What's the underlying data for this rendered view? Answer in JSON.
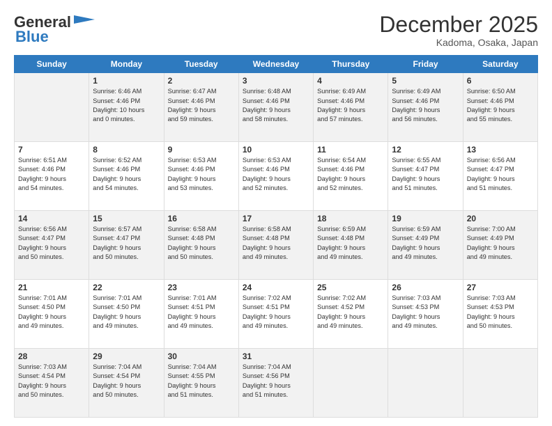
{
  "header": {
    "logo_line1": "General",
    "logo_line2": "Blue",
    "month": "December 2025",
    "location": "Kadoma, Osaka, Japan"
  },
  "weekdays": [
    "Sunday",
    "Monday",
    "Tuesday",
    "Wednesday",
    "Thursday",
    "Friday",
    "Saturday"
  ],
  "rows": [
    [
      {
        "num": "",
        "info": ""
      },
      {
        "num": "1",
        "info": "Sunrise: 6:46 AM\nSunset: 4:46 PM\nDaylight: 10 hours\nand 0 minutes."
      },
      {
        "num": "2",
        "info": "Sunrise: 6:47 AM\nSunset: 4:46 PM\nDaylight: 9 hours\nand 59 minutes."
      },
      {
        "num": "3",
        "info": "Sunrise: 6:48 AM\nSunset: 4:46 PM\nDaylight: 9 hours\nand 58 minutes."
      },
      {
        "num": "4",
        "info": "Sunrise: 6:49 AM\nSunset: 4:46 PM\nDaylight: 9 hours\nand 57 minutes."
      },
      {
        "num": "5",
        "info": "Sunrise: 6:49 AM\nSunset: 4:46 PM\nDaylight: 9 hours\nand 56 minutes."
      },
      {
        "num": "6",
        "info": "Sunrise: 6:50 AM\nSunset: 4:46 PM\nDaylight: 9 hours\nand 55 minutes."
      }
    ],
    [
      {
        "num": "7",
        "info": "Sunrise: 6:51 AM\nSunset: 4:46 PM\nDaylight: 9 hours\nand 54 minutes."
      },
      {
        "num": "8",
        "info": "Sunrise: 6:52 AM\nSunset: 4:46 PM\nDaylight: 9 hours\nand 54 minutes."
      },
      {
        "num": "9",
        "info": "Sunrise: 6:53 AM\nSunset: 4:46 PM\nDaylight: 9 hours\nand 53 minutes."
      },
      {
        "num": "10",
        "info": "Sunrise: 6:53 AM\nSunset: 4:46 PM\nDaylight: 9 hours\nand 52 minutes."
      },
      {
        "num": "11",
        "info": "Sunrise: 6:54 AM\nSunset: 4:46 PM\nDaylight: 9 hours\nand 52 minutes."
      },
      {
        "num": "12",
        "info": "Sunrise: 6:55 AM\nSunset: 4:47 PM\nDaylight: 9 hours\nand 51 minutes."
      },
      {
        "num": "13",
        "info": "Sunrise: 6:56 AM\nSunset: 4:47 PM\nDaylight: 9 hours\nand 51 minutes."
      }
    ],
    [
      {
        "num": "14",
        "info": "Sunrise: 6:56 AM\nSunset: 4:47 PM\nDaylight: 9 hours\nand 50 minutes."
      },
      {
        "num": "15",
        "info": "Sunrise: 6:57 AM\nSunset: 4:47 PM\nDaylight: 9 hours\nand 50 minutes."
      },
      {
        "num": "16",
        "info": "Sunrise: 6:58 AM\nSunset: 4:48 PM\nDaylight: 9 hours\nand 50 minutes."
      },
      {
        "num": "17",
        "info": "Sunrise: 6:58 AM\nSunset: 4:48 PM\nDaylight: 9 hours\nand 49 minutes."
      },
      {
        "num": "18",
        "info": "Sunrise: 6:59 AM\nSunset: 4:48 PM\nDaylight: 9 hours\nand 49 minutes."
      },
      {
        "num": "19",
        "info": "Sunrise: 6:59 AM\nSunset: 4:49 PM\nDaylight: 9 hours\nand 49 minutes."
      },
      {
        "num": "20",
        "info": "Sunrise: 7:00 AM\nSunset: 4:49 PM\nDaylight: 9 hours\nand 49 minutes."
      }
    ],
    [
      {
        "num": "21",
        "info": "Sunrise: 7:01 AM\nSunset: 4:50 PM\nDaylight: 9 hours\nand 49 minutes."
      },
      {
        "num": "22",
        "info": "Sunrise: 7:01 AM\nSunset: 4:50 PM\nDaylight: 9 hours\nand 49 minutes."
      },
      {
        "num": "23",
        "info": "Sunrise: 7:01 AM\nSunset: 4:51 PM\nDaylight: 9 hours\nand 49 minutes."
      },
      {
        "num": "24",
        "info": "Sunrise: 7:02 AM\nSunset: 4:51 PM\nDaylight: 9 hours\nand 49 minutes."
      },
      {
        "num": "25",
        "info": "Sunrise: 7:02 AM\nSunset: 4:52 PM\nDaylight: 9 hours\nand 49 minutes."
      },
      {
        "num": "26",
        "info": "Sunrise: 7:03 AM\nSunset: 4:53 PM\nDaylight: 9 hours\nand 49 minutes."
      },
      {
        "num": "27",
        "info": "Sunrise: 7:03 AM\nSunset: 4:53 PM\nDaylight: 9 hours\nand 50 minutes."
      }
    ],
    [
      {
        "num": "28",
        "info": "Sunrise: 7:03 AM\nSunset: 4:54 PM\nDaylight: 9 hours\nand 50 minutes."
      },
      {
        "num": "29",
        "info": "Sunrise: 7:04 AM\nSunset: 4:54 PM\nDaylight: 9 hours\nand 50 minutes."
      },
      {
        "num": "30",
        "info": "Sunrise: 7:04 AM\nSunset: 4:55 PM\nDaylight: 9 hours\nand 51 minutes."
      },
      {
        "num": "31",
        "info": "Sunrise: 7:04 AM\nSunset: 4:56 PM\nDaylight: 9 hours\nand 51 minutes."
      },
      {
        "num": "",
        "info": ""
      },
      {
        "num": "",
        "info": ""
      },
      {
        "num": "",
        "info": ""
      }
    ]
  ]
}
